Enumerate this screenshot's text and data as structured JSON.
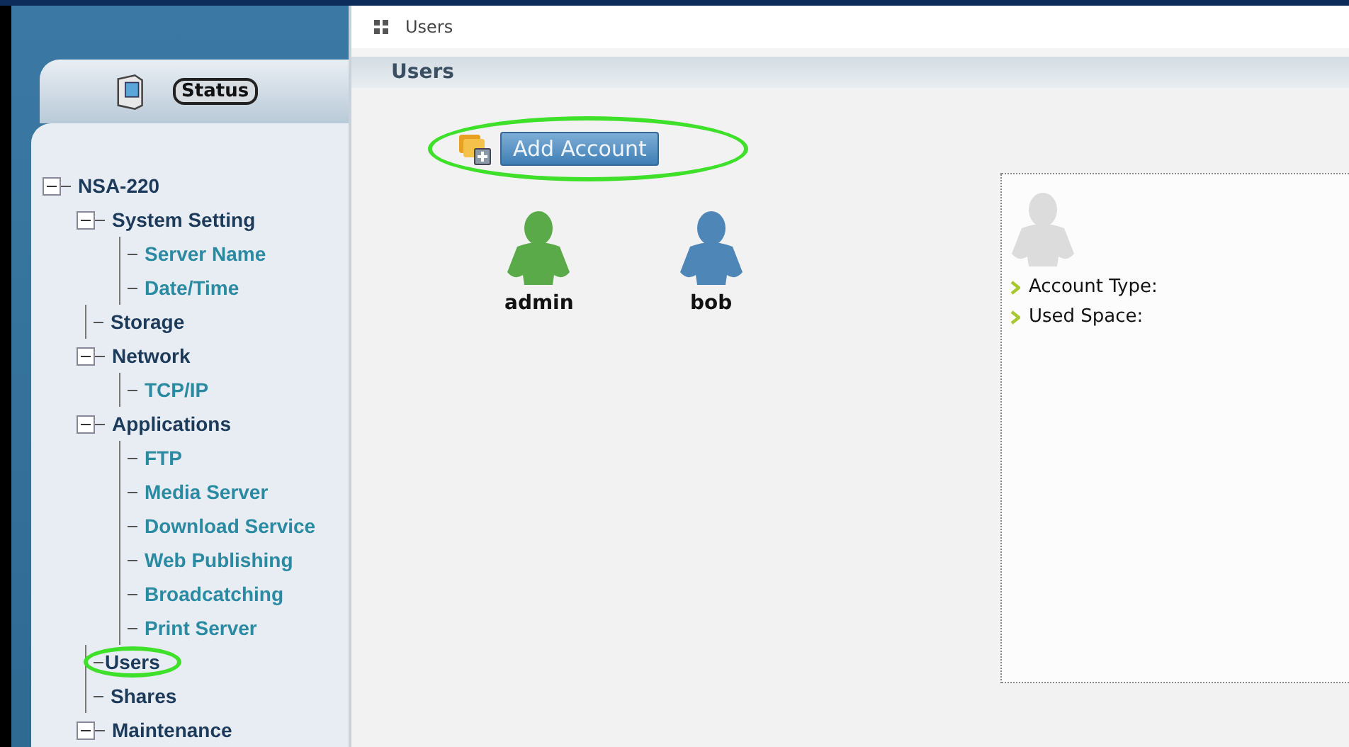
{
  "sidebar": {
    "status_tab": {
      "label": "Status"
    },
    "tree": [
      {
        "label": "NSA-220",
        "expanded": true,
        "children": [
          {
            "label": "System Setting",
            "expanded": true,
            "children": [
              {
                "label": "Server Name"
              },
              {
                "label": "Date/Time"
              }
            ]
          },
          {
            "label": "Storage"
          },
          {
            "label": "Network",
            "expanded": true,
            "children": [
              {
                "label": "TCP/IP"
              }
            ]
          },
          {
            "label": "Applications",
            "expanded": true,
            "children": [
              {
                "label": "FTP"
              },
              {
                "label": "Media Server"
              },
              {
                "label": "Download Service"
              },
              {
                "label": "Web Publishing"
              },
              {
                "label": "Broadcatching"
              },
              {
                "label": "Print Server"
              }
            ]
          },
          {
            "label": "Users",
            "highlighted": true
          },
          {
            "label": "Shares"
          },
          {
            "label": "Maintenance",
            "expanded": true
          }
        ]
      }
    ]
  },
  "breadcrumb": "Users",
  "panel_title": "Users",
  "add_account": {
    "label": "Add Account",
    "highlighted": true
  },
  "users": [
    {
      "name": "admin",
      "color": "#5aaa4a"
    },
    {
      "name": "bob",
      "color": "#4f86b8"
    }
  ],
  "details": {
    "fields": [
      "Account Type:",
      "Used Space:"
    ]
  }
}
